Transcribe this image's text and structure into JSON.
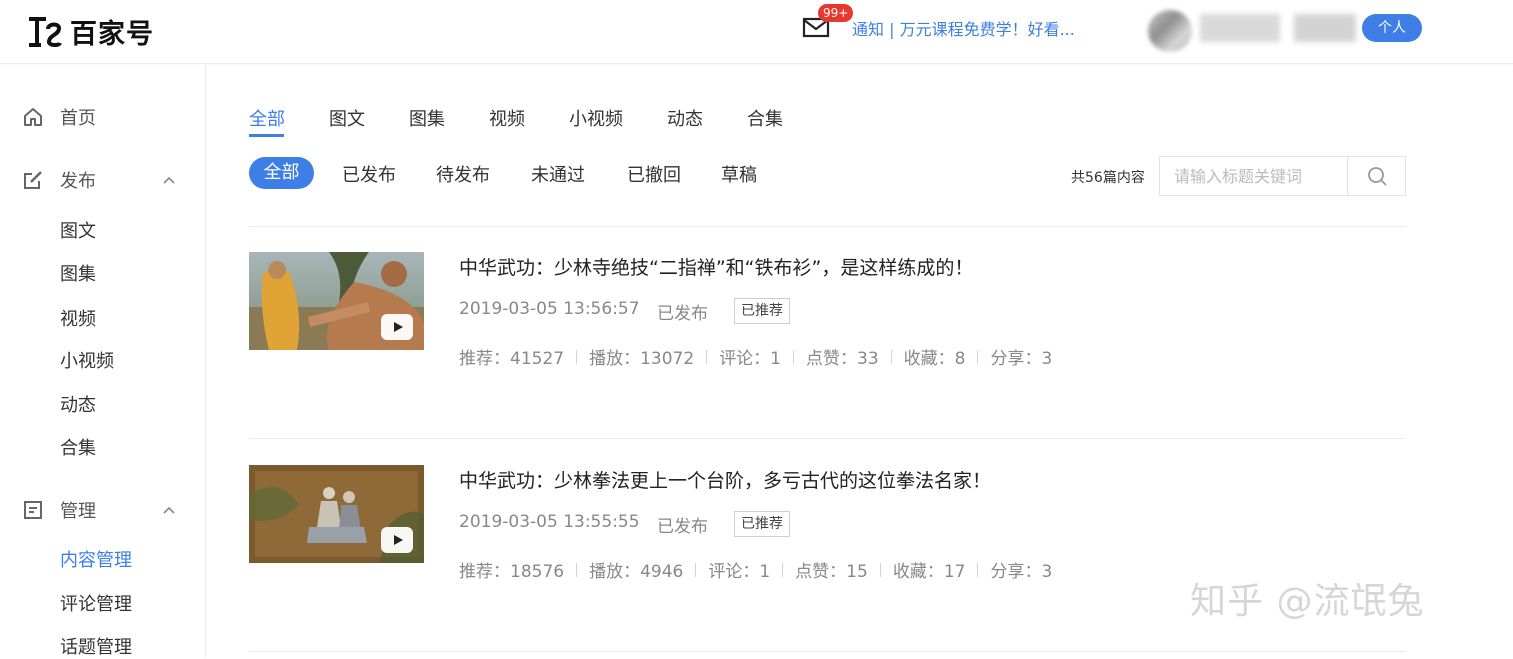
{
  "header": {
    "brand": "百家号",
    "mail_badge": "99+",
    "notice_text": "通知 | 万元课程免费学！好看...",
    "role_button": "个人"
  },
  "sidebar": {
    "home": "首页",
    "publish": "发布",
    "publish_items": [
      "图文",
      "图集",
      "视频",
      "小视频",
      "动态",
      "合集"
    ],
    "manage": "管理",
    "manage_items": [
      "内容管理",
      "评论管理",
      "话题管理"
    ]
  },
  "tabs": [
    "全部",
    "图文",
    "图集",
    "视频",
    "小视频",
    "动态",
    "合集"
  ],
  "filters": [
    "全部",
    "已发布",
    "待发布",
    "未通过",
    "已撤回",
    "草稿"
  ],
  "count_text": "共56篇内容",
  "search": {
    "placeholder": "请输入标题关键词"
  },
  "articles": [
    {
      "title": "中华武功：少林寺绝技“二指禅”和“铁布衫”，是这样练成的！",
      "date": "2019-03-05 13:56:57",
      "status": "已发布",
      "badge": "已推荐",
      "stats": [
        "推荐：41527",
        "播放：13072",
        "评论：1",
        "点赞：33",
        "收藏：8",
        "分享：3"
      ]
    },
    {
      "title": "中华武功：少林拳法更上一个台阶，多亏古代的这位拳法名家！",
      "date": "2019-03-05 13:55:55",
      "status": "已发布",
      "badge": "已推荐",
      "stats": [
        "推荐：18576",
        "播放：4946",
        "评论：1",
        "点赞：15",
        "收藏：17",
        "分享：3"
      ]
    }
  ],
  "watermark": "知乎 @流氓兔",
  "colors": {
    "accent": "#3d7fe6",
    "badge_red": "#e7382f"
  }
}
